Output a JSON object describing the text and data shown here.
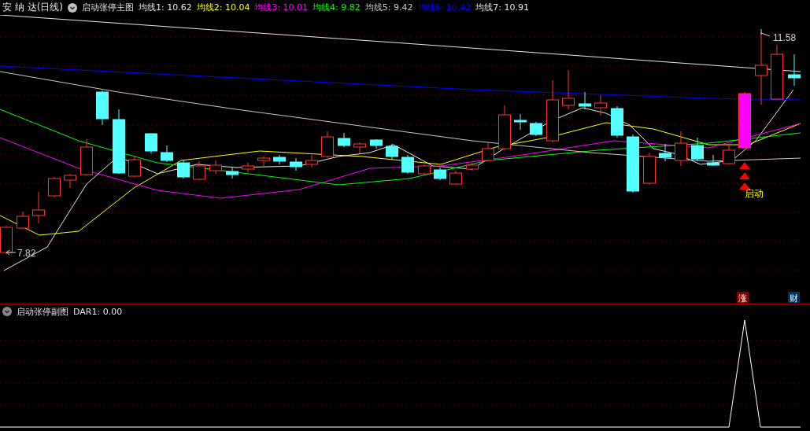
{
  "title": "安 纳 达(日线)",
  "main_panel": {
    "indicator": "启动张停主图",
    "ma_legend": [
      {
        "label": "均线1: 10.62",
        "color": "#e6e6e6"
      },
      {
        "label": "均线2: 10.04",
        "color": "#ffff00"
      },
      {
        "label": "均线3: 10.01",
        "color": "#ff00ff"
      },
      {
        "label": "均线4: 9.82",
        "color": "#00ff00"
      },
      {
        "label": "均线5: 9.42",
        "color": "#c8c8c8"
      },
      {
        "label": "均线6: 10.42",
        "color": "#0000ff"
      },
      {
        "label": "均线7: 10.91",
        "color": "#e6e6e6"
      }
    ],
    "high_label": "11.58",
    "low_label": "7.82",
    "signal_label": "启动",
    "badges": [
      {
        "text": "涨",
        "color": "#800000"
      },
      {
        "text": "财",
        "color": "#003366"
      }
    ]
  },
  "sub_panel": {
    "indicator": "启动张停副图",
    "reading": "DAR1: 0.00"
  }
}
